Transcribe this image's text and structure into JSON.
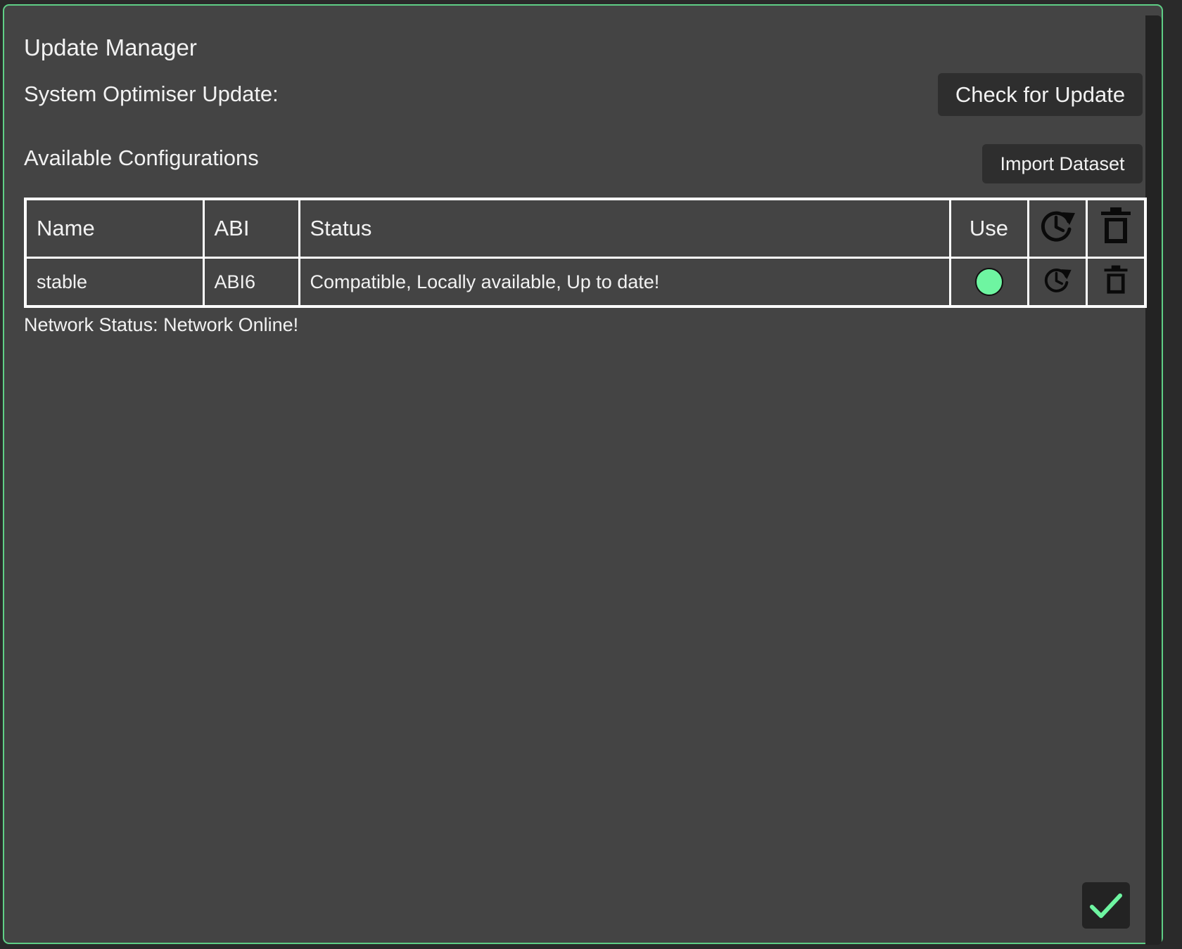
{
  "window": {
    "title": "Update Manager"
  },
  "optimiser": {
    "label": "System Optimiser Update:",
    "check_button": "Check for Update"
  },
  "configurations": {
    "heading": "Available Configurations",
    "import_button": "Import Dataset",
    "columns": {
      "name": "Name",
      "abi": "ABI",
      "status": "Status",
      "use": "Use",
      "update_icon": "update-icon",
      "delete_icon": "trash-icon"
    },
    "rows": [
      {
        "name": "stable",
        "abi": "ABI6",
        "status": "Compatible, Locally available, Up to date!",
        "in_use": true
      }
    ]
  },
  "network": {
    "status_text": "Network Status: Network Online!"
  },
  "footer": {
    "confirm_icon": "checkmark-icon"
  },
  "colors": {
    "accent": "#6ef5a1",
    "border": "#5fcf86",
    "panel": "#444444",
    "button": "#2e2e2e"
  }
}
